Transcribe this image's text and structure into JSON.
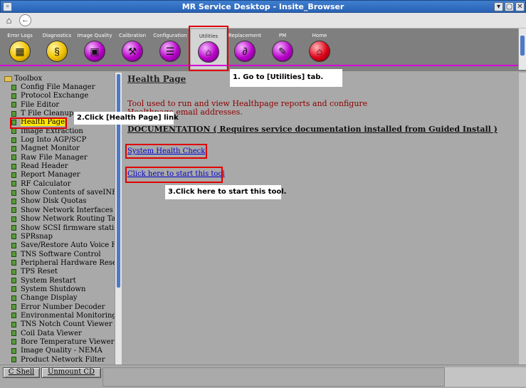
{
  "window": {
    "title": "MR Service Desktop - Insite_Browser",
    "controls": {
      "minimize": "▾",
      "maximize": "▢",
      "close": "✕"
    }
  },
  "nav": {
    "home_icon": "home-icon",
    "back_icon": "back-arrow-icon"
  },
  "tabs": [
    {
      "label": "Error Logs",
      "icon": "error-logs-icon",
      "color": "#f0c000",
      "glyph": "▦"
    },
    {
      "label": "Diagnostics",
      "icon": "stethoscope-icon",
      "color": "#f0c000",
      "glyph": "§"
    },
    {
      "label": "Image Quality",
      "icon": "image-quality-icon",
      "color": "#b800c8",
      "glyph": "▣"
    },
    {
      "label": "Calibration",
      "icon": "calibration-icon",
      "color": "#b800c8",
      "glyph": "⚒"
    },
    {
      "label": "Configuration",
      "icon": "configuration-icon",
      "color": "#b800c8",
      "glyph": "☰"
    },
    {
      "label": "Utilities",
      "icon": "utilities-icon",
      "color": "#b800c8",
      "glyph": "⌂"
    },
    {
      "label": "Replacement",
      "icon": "replacement-icon",
      "color": "#b800c8",
      "glyph": "∂"
    },
    {
      "label": "PM",
      "icon": "pm-icon",
      "color": "#b800c8",
      "glyph": "✎"
    },
    {
      "label": "Home",
      "icon": "home-tab-icon",
      "color": "#e00018",
      "glyph": "⌂"
    }
  ],
  "active_tab": "Utilities",
  "sidebar": {
    "root_label": "Toolbox",
    "selected": "Health Page",
    "items": [
      "Config File Manager",
      "Protocol Exchange",
      "File Editor",
      "T File Cleanup",
      "Health Page",
      "Image Extraction",
      "Log Into AGP/SCP",
      "Magnet Monitor",
      "Raw File Manager",
      "Read Header",
      "Report Manager",
      "RF Calculator",
      "Show Contents of saveINFO",
      "Show Disk Quotas",
      "Show Network Interfaces",
      "Show Network Routing Table",
      "Show SCSI firmware statistics",
      "SPRsnap",
      "Save/Restore Auto Voice Files",
      "TNS Software Control",
      "Peripheral Hardware Reset",
      "TPS Reset",
      "System Restart",
      "System Shutdown",
      "Change Display",
      "Error Number Decoder",
      "Environmental Monitoring",
      "TNS Notch Count Viewer",
      "Coil Data Viewer",
      "Bore Temperature Viewer",
      "Image Quality - NEMA",
      "Product Network Filter"
    ]
  },
  "content": {
    "title": "Health Page",
    "description": "Tool used to run and view Healthpage reports and configure Healthpage email addresses.",
    "documentation_heading": "DOCUMENTATION ( Requires service documentation installed from Guided Install )",
    "link_health_check": "System Health Check",
    "link_start_tool": "Click here to start this tool"
  },
  "callouts": {
    "step1": "1. Go to [Utilities] tab.",
    "step2": "2.Click [Health Page] link",
    "step3": "3.Click here to start this tool."
  },
  "bottom": {
    "shell_button": "C Shell",
    "unmount_button": "Unmount CD"
  },
  "colors": {
    "highlight": "#e00000",
    "selected_item": "#ffea00",
    "link": "#0000cc",
    "description": "#8b0000"
  }
}
